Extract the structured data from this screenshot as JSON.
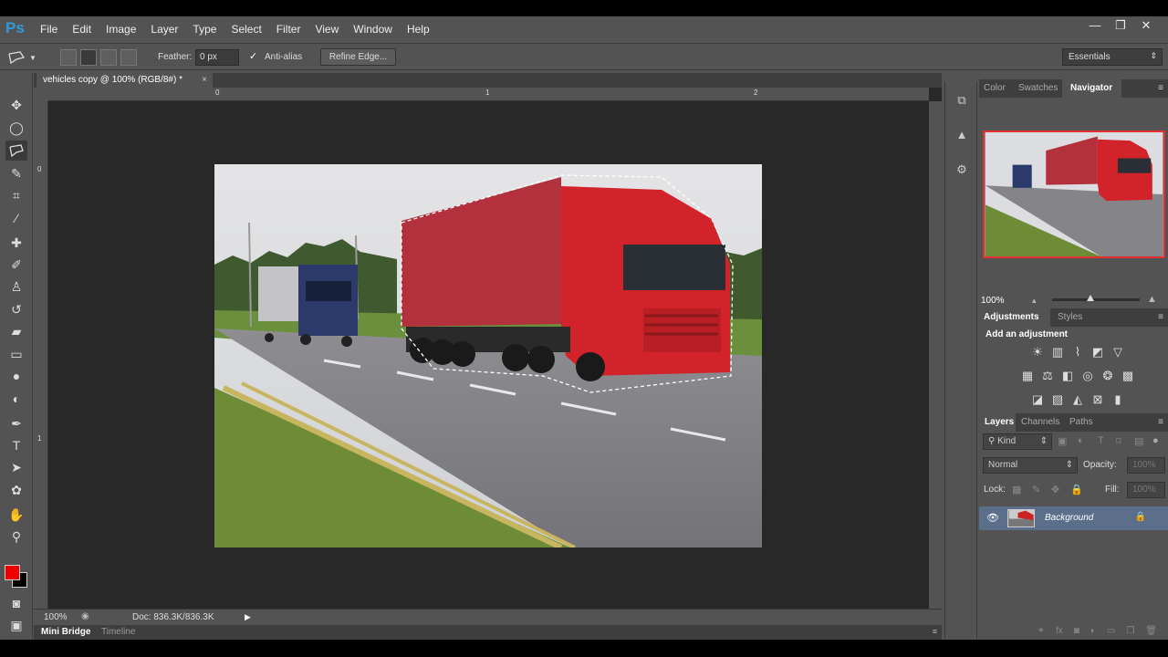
{
  "app": {
    "logo": "Ps",
    "menu": [
      "File",
      "Edit",
      "Image",
      "Layer",
      "Type",
      "Select",
      "Filter",
      "View",
      "Window",
      "Help"
    ],
    "window_controls": [
      "—",
      "❐",
      "✕"
    ]
  },
  "options_bar": {
    "feather_label": "Feather:",
    "feather_value": "0 px",
    "antialias_label": "Anti-alias",
    "antialias_checked": "✓",
    "refine_edge_label": "Refine Edge...",
    "workspace": "Essentials"
  },
  "document": {
    "tab_title": "vehicles copy @ 100% (RGB/8#) *",
    "tab_close": "×",
    "ruler_h_labels": [
      "0",
      "1",
      "2"
    ],
    "ruler_v_labels": [
      "0",
      "1"
    ]
  },
  "status": {
    "zoom": "100%",
    "doc_info": "Doc: 836.3K/836.3K"
  },
  "bottom_tabs": {
    "mini_bridge": "Mini Bridge",
    "timeline": "Timeline"
  },
  "colors": {
    "foreground": "#ee0000",
    "background": "#000000",
    "navigator_frame": "#e03030"
  },
  "panels": {
    "top_tabs": [
      "Color",
      "Swatches",
      "Navigator"
    ],
    "navigator_zoom": "100%",
    "adjustments_tabs": [
      "Adjustments",
      "Styles"
    ],
    "adjustments_title": "Add an adjustment",
    "layers_tabs": [
      "Layers",
      "Channels",
      "Paths"
    ],
    "kind_label": "Kind",
    "blend_mode": "Normal",
    "opacity_label": "Opacity:",
    "opacity_value": "100%",
    "lock_label": "Lock:",
    "fill_label": "Fill:",
    "fill_value": "100%",
    "layer_name": "Background"
  },
  "icons": {
    "tools": [
      "move-icon",
      "elliptical-marquee-icon",
      "polygonal-lasso-icon",
      "quick-selection-icon",
      "crop-icon",
      "eyedropper-icon",
      "healing-brush-icon",
      "brush-icon",
      "clone-stamp-icon",
      "history-brush-icon",
      "eraser-icon",
      "gradient-icon",
      "blur-icon",
      "dodge-icon",
      "pen-icon",
      "type-icon",
      "path-selection-icon",
      "shape-icon",
      "hand-icon",
      "zoom-icon"
    ]
  }
}
